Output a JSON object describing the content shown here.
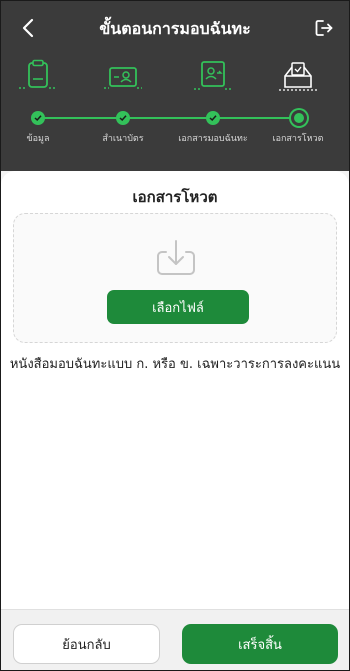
{
  "header": {
    "title": "ขั้นตอนการมอบฉันทะ",
    "back_icon": "chevron-left-icon",
    "logout_icon": "logout-icon"
  },
  "steps": [
    {
      "label": "ข้อมูล",
      "icon": "clipboard-icon",
      "status": "done"
    },
    {
      "label": "สำเนาบัตร",
      "icon": "id-card-icon",
      "status": "done"
    },
    {
      "label": "เอกสารมอบฉันทะ",
      "icon": "document-transfer-icon",
      "status": "done"
    },
    {
      "label": "เอกสารโหวต",
      "icon": "ballot-box-icon",
      "status": "current"
    }
  ],
  "content": {
    "title": "เอกสารโหวต",
    "upload_icon": "download-box-icon",
    "choose_file_label": "เลือกไฟล์",
    "description": "หนังสือมอบฉันทะแบบ ก. หรือ ข. เฉพาะวาระการลงคะแนน"
  },
  "footer": {
    "back_label": "ย้อนกลับ",
    "finish_label": "เสร็จสิ้น"
  },
  "colors": {
    "header_bg": "#3b3b3b",
    "accent_green": "#1e8a3a",
    "step_green": "#33c15a"
  }
}
